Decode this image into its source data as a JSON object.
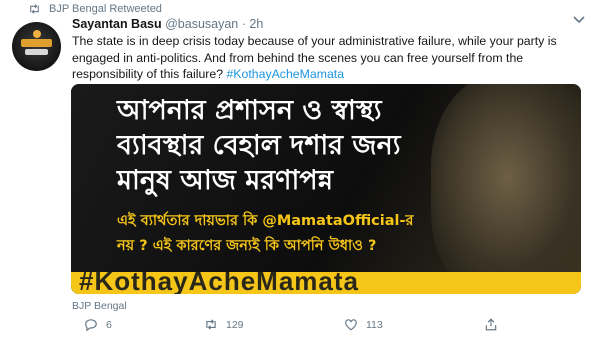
{
  "retweet_bar": {
    "text": "BJP Bengal Retweeted"
  },
  "tweet": {
    "author_name": "Sayantan Basu",
    "handle": "@basusayan",
    "separator": "·",
    "time": "2h",
    "text": "The state is in deep crisis today because of your administrative failure, while your party is engaged in anti-politics. And from behind the scenes you can free yourself from the responsibility of this failure? ",
    "hashtag": "#KothayAcheMamata"
  },
  "media": {
    "line1": "আপনার প্রশাসন ও স্বাস্থ্য",
    "line2": "ব্যাবস্থার বেহাল দশার জন্য",
    "line3": "মানুষ আজ মরণাপন্ন",
    "sub1": "এই ব্যার্থতার দায়ভার কি @MamataOfficial-র",
    "sub2": "নয় ? এই কারণের জন্যই কি আপনি উধাও ?",
    "banner": "#KothayAcheMamata",
    "accent_color": "#f5c518"
  },
  "source_label": "BJP Bengal",
  "actions": {
    "reply_count": "6",
    "retweet_count": "129",
    "like_count": "113"
  },
  "icons": [
    "retweet-icon",
    "chevron-down-icon",
    "reply-icon",
    "like-icon",
    "share-icon"
  ],
  "colors": {
    "link": "#1b95e0",
    "muted": "#657786",
    "text": "#14171a"
  }
}
